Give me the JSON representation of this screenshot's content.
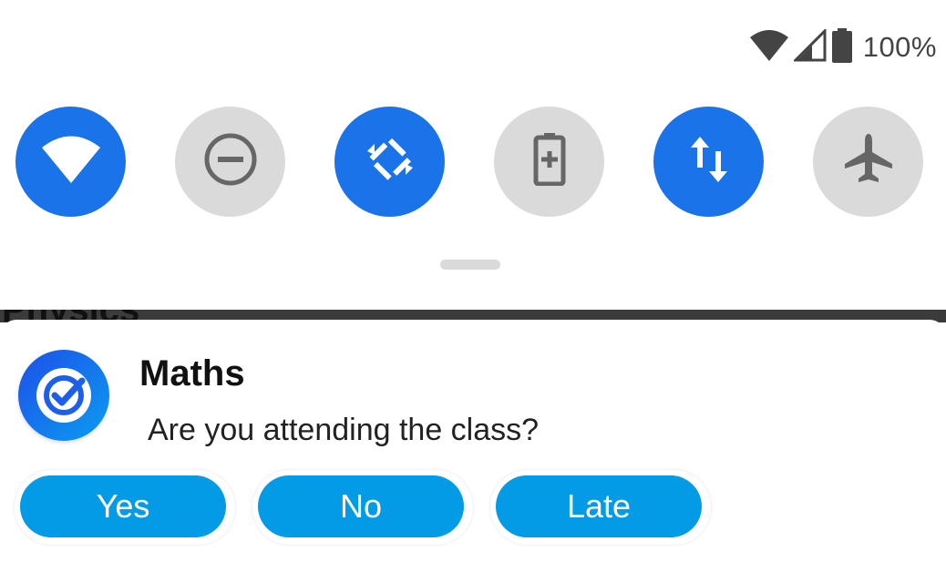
{
  "status_bar": {
    "battery_percent": "100%",
    "icons": [
      "wifi-icon",
      "cell-signal-icon",
      "battery-icon"
    ]
  },
  "quick_settings": {
    "tiles": [
      {
        "name": "wifi",
        "icon": "wifi-icon",
        "state": "on"
      },
      {
        "name": "do-not-disturb",
        "icon": "dnd-icon",
        "state": "off"
      },
      {
        "name": "auto-rotate",
        "icon": "rotate-icon",
        "state": "on"
      },
      {
        "name": "battery-saver",
        "icon": "battery-saver-icon",
        "state": "off"
      },
      {
        "name": "mobile-data",
        "icon": "data-arrows-icon",
        "state": "on"
      },
      {
        "name": "airplane-mode",
        "icon": "airplane-icon",
        "state": "off"
      }
    ],
    "colors": {
      "on": "#1a73e8",
      "off": "#dadada"
    }
  },
  "background_app": {
    "partial_heading": "Physics"
  },
  "notification": {
    "app_icon": "checkmark-target-icon",
    "title": "Maths",
    "text": "Are you attending the class?",
    "actions": [
      {
        "label": "Yes"
      },
      {
        "label": "No"
      },
      {
        "label": "Late"
      }
    ],
    "action_color": "#039be5"
  }
}
